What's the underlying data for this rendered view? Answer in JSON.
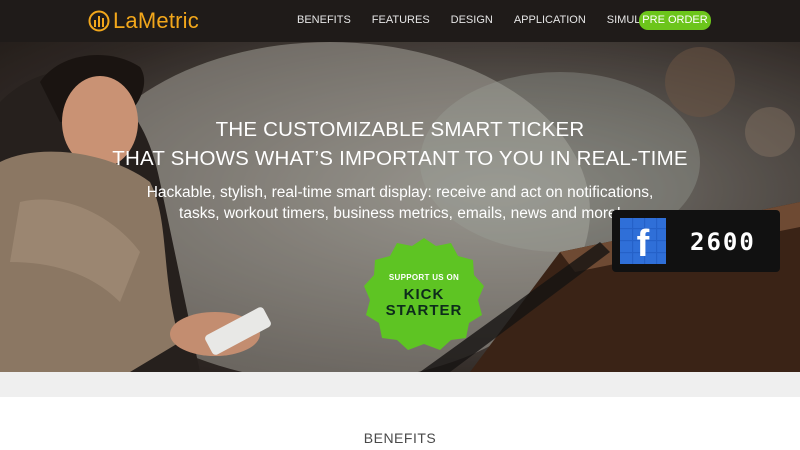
{
  "brand": {
    "name": "LaMetric",
    "color": "#f2a71b"
  },
  "nav": {
    "items": [
      "BENEFITS",
      "FEATURES",
      "DESIGN",
      "APPLICATION",
      "SIMULATOR"
    ],
    "cta": "PRE ORDER",
    "cta_color": "#6cc51b"
  },
  "hero": {
    "title_line1": "THE CUSTOMIZABLE SMART TICKER",
    "title_line2": "THAT SHOWS WHAT’S IMPORTANT TO YOU IN REAL-TIME",
    "subtitle_line1": "Hackable, stylish, real-time smart display: receive and act on notifications,",
    "subtitle_line2": "tasks, workout timers, business metrics, emails, news and more!",
    "kickstarter": {
      "small": "SUPPORT US ON",
      "line1": "KICK",
      "line2": "STARTER"
    },
    "device": {
      "icon": "facebook-icon",
      "count": "2600"
    }
  },
  "section": {
    "title": "BENEFITS"
  }
}
